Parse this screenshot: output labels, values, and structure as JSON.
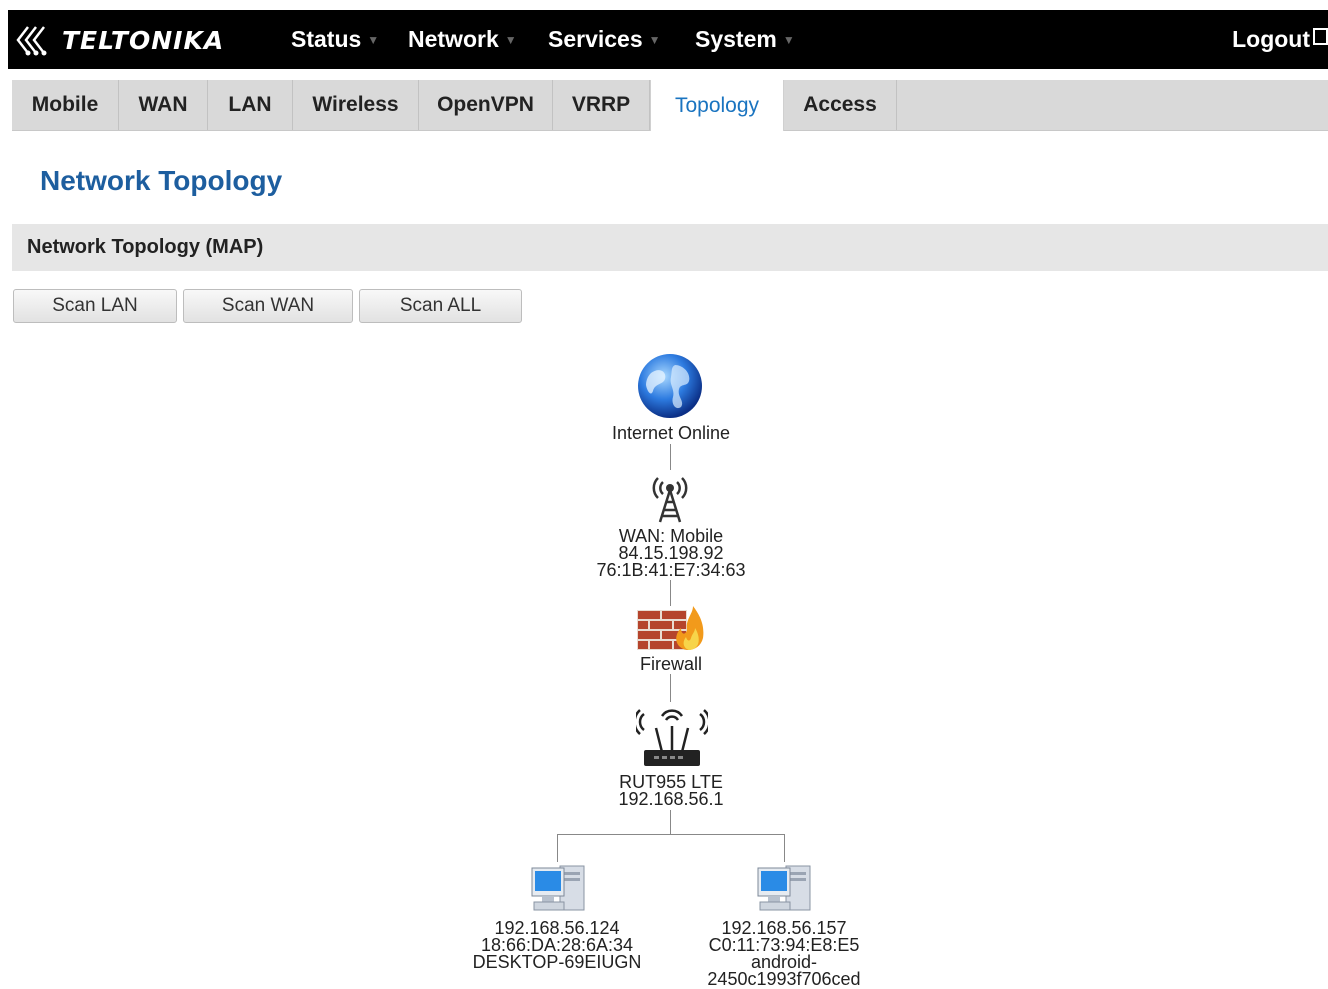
{
  "brand": {
    "name": "TELTONIKA"
  },
  "nav": {
    "status": "Status",
    "network": "Network",
    "services": "Services",
    "system": "System",
    "logout": "Logout"
  },
  "tabs": [
    "Mobile",
    "WAN",
    "LAN",
    "Wireless",
    "OpenVPN",
    "VRRP",
    "Topology",
    "Access"
  ],
  "active_tab": "Topology",
  "page": {
    "title": "Network Topology",
    "section_title": "Network Topology (MAP)"
  },
  "buttons": {
    "scan_lan": "Scan LAN",
    "scan_wan": "Scan WAN",
    "scan_all": "Scan ALL"
  },
  "topology": {
    "internet": {
      "label": "Internet Online",
      "icon": "globe-icon"
    },
    "wan": {
      "line1": "WAN: Mobile",
      "line2": "84.15.198.92",
      "line3": "76:1B:41:E7:34:63",
      "icon": "cell-tower-icon"
    },
    "firewall": {
      "label": "Firewall",
      "icon": "firewall-icon"
    },
    "router": {
      "line1": "RUT955 LTE",
      "line2": "192.168.56.1",
      "icon": "router-icon"
    },
    "clients": [
      {
        "ip": "192.168.56.124",
        "mac": "18:66:DA:28:6A:34",
        "name": "DESKTOP-69EIUGN",
        "name2": "",
        "icon": "computer-icon"
      },
      {
        "ip": "192.168.56.157",
        "mac": "C0:11:73:94:E8:E5",
        "name": "android-",
        "name2": "2450c1993f706ced",
        "icon": "computer-icon"
      }
    ]
  },
  "colors": {
    "header_bg": "#000000",
    "tab_bg": "#d9d9d9",
    "active_tab_text": "#1a74c0",
    "title": "#1d5e9f"
  }
}
